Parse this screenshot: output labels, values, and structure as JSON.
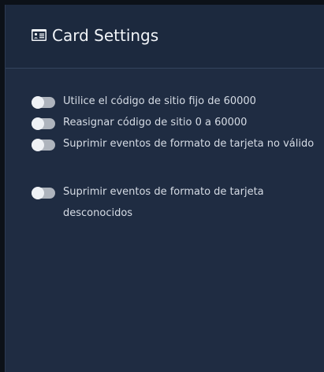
{
  "header": {
    "icon": "id-card-icon",
    "title": "Card Settings"
  },
  "colors": {
    "panel_background": "#1f2c42",
    "header_background": "#1c293e",
    "toggle_track": "#aeb4bd",
    "text": "#d6dce5"
  },
  "settings": [
    {
      "label": "Utilice el código de sitio fijo de 60000",
      "enabled": false
    },
    {
      "label": "Reasignar código de sitio 0 a 60000",
      "enabled": false
    },
    {
      "label": "Suprimir eventos de formato de tarjeta no válido",
      "enabled": false
    },
    {
      "label": "Suprimir eventos de formato de tarjeta desconocidos",
      "enabled": false
    }
  ]
}
